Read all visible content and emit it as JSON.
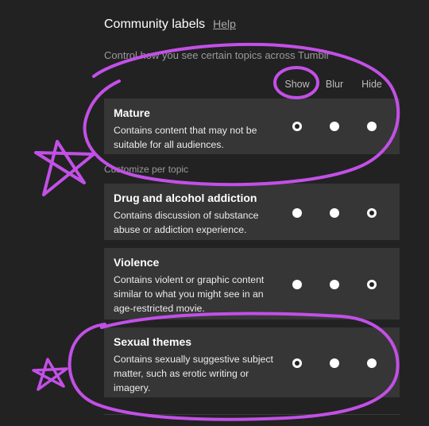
{
  "header": {
    "title": "Community labels",
    "help": "Help"
  },
  "subtitle": "Control how you see certain topics across Tumblr",
  "columns": {
    "show": "Show",
    "blur": "Blur",
    "hide": "Hide"
  },
  "customize_label": "Customize per topic",
  "topics": [
    {
      "title": "Mature",
      "description": "Contains content that may not be suitable for all audiences.",
      "selected": "show"
    },
    {
      "title": "Drug and alcohol addiction",
      "description": "Contains discussion of substance abuse or addiction experience.",
      "selected": "hide"
    },
    {
      "title": "Violence",
      "description": "Contains violent or graphic content similar to what you might see in an age-restricted movie.",
      "selected": "hide"
    },
    {
      "title": "Sexual themes",
      "description": "Contains sexually suggestive subject matter, such as erotic writing or imagery.",
      "selected": "show"
    }
  ],
  "colors": {
    "background": "#222222",
    "card": "#363636",
    "annotation": "#c250e6"
  }
}
